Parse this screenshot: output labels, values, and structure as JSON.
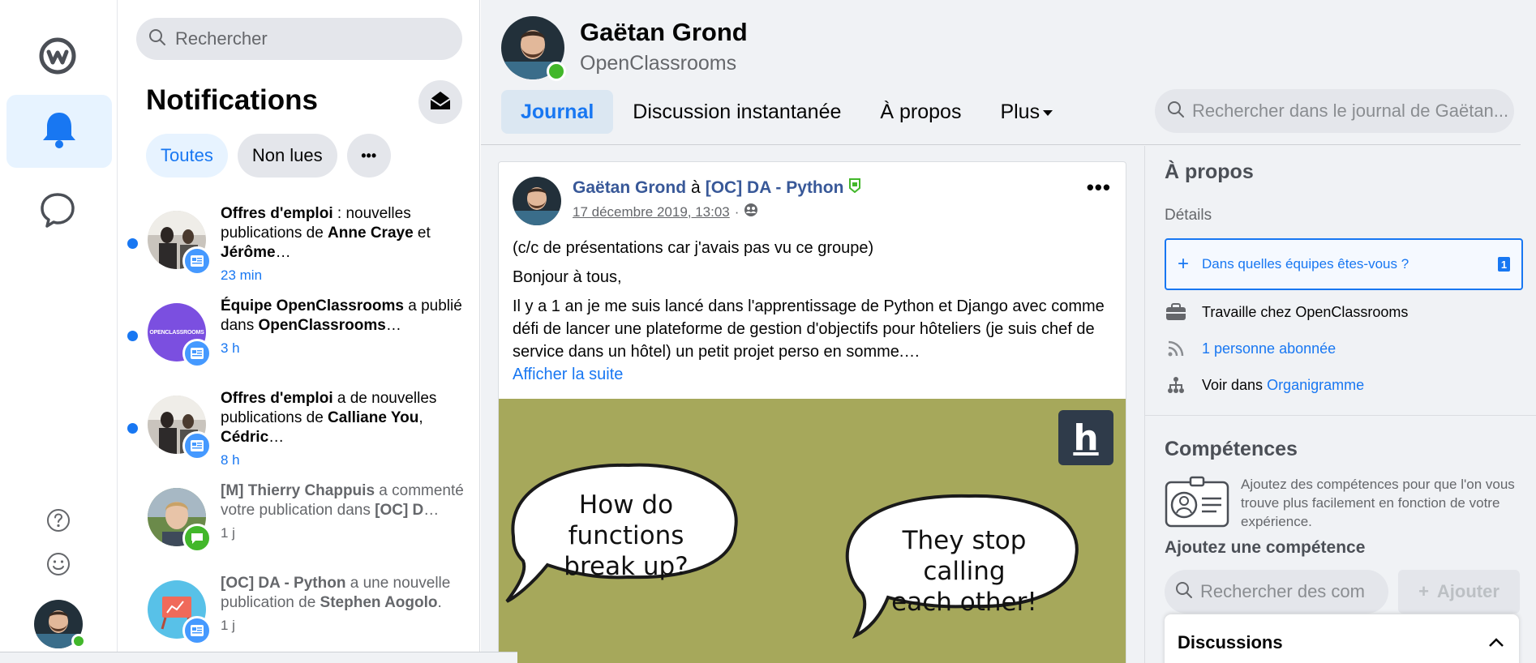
{
  "rail": {
    "logo_icon": "workplace-logo-icon",
    "items": [
      {
        "name": "notifications",
        "icon": "bell-icon",
        "active": true
      },
      {
        "name": "chat",
        "icon": "speech-bubble-icon",
        "active": false
      }
    ],
    "help_icon": "question-circle-icon",
    "feedback_icon": "smiley-icon"
  },
  "notifications": {
    "search_placeholder": "Rechercher",
    "title": "Notifications",
    "filters": {
      "all": "Toutes",
      "unread": "Non lues",
      "more": "•••"
    },
    "items": [
      {
        "segments": [
          [
            "b",
            "Offres d'emploi"
          ],
          [
            "t",
            " : nouvelles publications de "
          ],
          [
            "b",
            "Anne Craye"
          ],
          [
            "t",
            " et "
          ],
          [
            "b",
            "Jérôme"
          ],
          [
            "t",
            "…"
          ]
        ],
        "time": "23 min",
        "unread": true,
        "badge_color": "#4599ff"
      },
      {
        "segments": [
          [
            "b",
            "Équipe OpenClassrooms"
          ],
          [
            "t",
            " a publié dans "
          ],
          [
            "b",
            "OpenClassrooms"
          ],
          [
            "t",
            "…"
          ]
        ],
        "time": "3 h",
        "unread": true,
        "badge_color": "#4599ff",
        "avatar_text": "OPENCLASSROOMS"
      },
      {
        "segments": [
          [
            "b",
            "Offres d'emploi"
          ],
          [
            "t",
            " a de nouvelles publications de "
          ],
          [
            "b",
            "Calliane You"
          ],
          [
            "t",
            ", "
          ],
          [
            "b",
            "Cédric"
          ],
          [
            "t",
            "…"
          ]
        ],
        "time": "8 h",
        "unread": true,
        "badge_color": "#4599ff"
      },
      {
        "segments": [
          [
            "b",
            "[M] Thierry Chappuis"
          ],
          [
            "t",
            " a commenté votre publication dans "
          ],
          [
            "b",
            "[OC] D"
          ],
          [
            "t",
            "…"
          ]
        ],
        "time": "1 j",
        "unread": false,
        "badge_color": "#42b72a"
      },
      {
        "segments": [
          [
            "b",
            "[OC] DA - Python"
          ],
          [
            "t",
            " a une nouvelle publication de "
          ],
          [
            "b",
            "Stephen Aogolo"
          ],
          [
            "t",
            "."
          ]
        ],
        "time": "1 j",
        "unread": false,
        "badge_color": "#4599ff"
      }
    ]
  },
  "profile": {
    "name": "Gaëtan Grond",
    "org": "OpenClassrooms",
    "tabs": [
      {
        "label": "Journal",
        "active": true
      },
      {
        "label": "Discussion instantanée",
        "active": false
      },
      {
        "label": "À propos",
        "active": false
      },
      {
        "label": "Plus",
        "active": false
      }
    ],
    "journal_search_placeholder": "Rechercher dans le journal de Gaëtan..."
  },
  "post": {
    "author": "Gaëtan Grond",
    "preposition": "à",
    "group": "[OC] DA - Python",
    "date": "17 décembre 2019, 13:03",
    "separator": "·",
    "menu": "•••",
    "paragraphs": [
      "(c/c de présentations car j'avais pas vu ce groupe)",
      "Bonjour à tous,",
      "Il y a 1 an je me suis lancé dans l'apprentissage de Python et Django avec comme défi de lancer une plateforme de gestion d'objectifs pour hôteliers (je suis chef de service dans un hôtel) un petit projet perso en somme.…"
    ],
    "see_more": "Afficher la suite",
    "image": {
      "bubble1": [
        "How do functions",
        "break up?"
      ],
      "bubble2": [
        "They stop calling",
        "each other!"
      ],
      "logo_letter": "h"
    }
  },
  "about": {
    "title": "À propos",
    "details_label": "Détails",
    "team_prompt": "Dans quelles équipes êtes-vous ?",
    "team_count": "1",
    "works_at": "Travaille chez OpenClassrooms",
    "followers": "1 personne abonnée",
    "org_chart_prefix": "Voir dans ",
    "org_chart_link": "Organigramme"
  },
  "skills": {
    "title": "Compétences",
    "description": "Ajoutez des compétences pour que l'on vous trouve plus facilement en fonction de votre expérience.",
    "add_title": "Ajoutez une compétence",
    "search_placeholder": "Rechercher des com",
    "add_button": "Ajouter"
  },
  "discussions": {
    "title": "Discussions"
  }
}
